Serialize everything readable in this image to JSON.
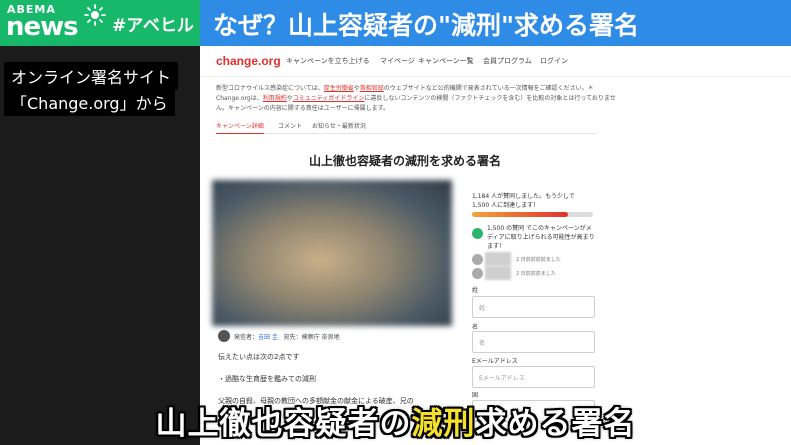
{
  "banner": {
    "logo_top": "ABEMA",
    "logo_bottom": "news",
    "hashtag": "#アベヒル",
    "headline": "なぜ？山上容疑者の\"減刑\"求める署名",
    "colors": {
      "logo_bg": "#18b86a",
      "headline_bg": "#2e8be6"
    }
  },
  "side_captions": {
    "line1": "オンライン署名サイト",
    "line2": "「Change.org」から"
  },
  "site": {
    "brand": "change.org",
    "nav": [
      "キャンペーンを立ち上げる",
      "マイページ",
      "キャンペーン一覧",
      "会員プログラム",
      "ログイン"
    ],
    "notice_pre": "新型コロナウイルス感染症については、",
    "notice_link1": "厚生労働省",
    "notice_mid1": "や",
    "notice_link2": "首相官邸",
    "notice_mid2": "のウェブサイトなど公的機関で発表されている一次情報をご確認ください。＊Change.orgは、",
    "notice_link3": "利用規約",
    "notice_mid3": "や",
    "notice_link4": "コミュニティガイドライン",
    "notice_post": "に違反しないコンテンツの検閲（ファクトチェックを含む）を比較の対象とは行っておりません。キャンペーンの内容に関する責任はユーザーに帰属します。",
    "tabs": [
      "キャンペーン詳細",
      "コメント",
      "お知らせ・最新状況"
    ],
    "petition_title": "山上徹也容疑者の減刑を求める署名",
    "starter_prefix": "発信者：",
    "starter_name": "吉田 圭",
    "recipient": "宛先：検察庁 奈良地",
    "body_line1": "伝えたい点は次の2点です",
    "body_line2": "・過酷な生育歴を鑑みての減刑",
    "body_line3": "父親の自殺、母親の教団への多額献金の献金による破産、兄の",
    "sig_count_line1": "1,184 人が賛同しました。もう少しで",
    "sig_count_line2": "1,500 人に到達します！",
    "progress_fraction": 0.79,
    "promo": "1,500 の賛同 でこのキャンペーンがメディアに取り上げられる可能性が高まります！",
    "signers": [
      "2 日前前前前ました",
      "2 日前前前ました"
    ],
    "form": {
      "last_name_label": "姓",
      "last_name_ph": "姓",
      "first_name_label": "名",
      "first_name_ph": "名",
      "email_label": "Eメールアドレス",
      "email_ph": "Eメールアドレス",
      "country_label": "国"
    }
  },
  "bottom_caption": {
    "pre": "山上徹也容疑者の",
    "highlight": "減刑",
    "post": "求める署名",
    "highlight_color": "#f5e12c"
  }
}
